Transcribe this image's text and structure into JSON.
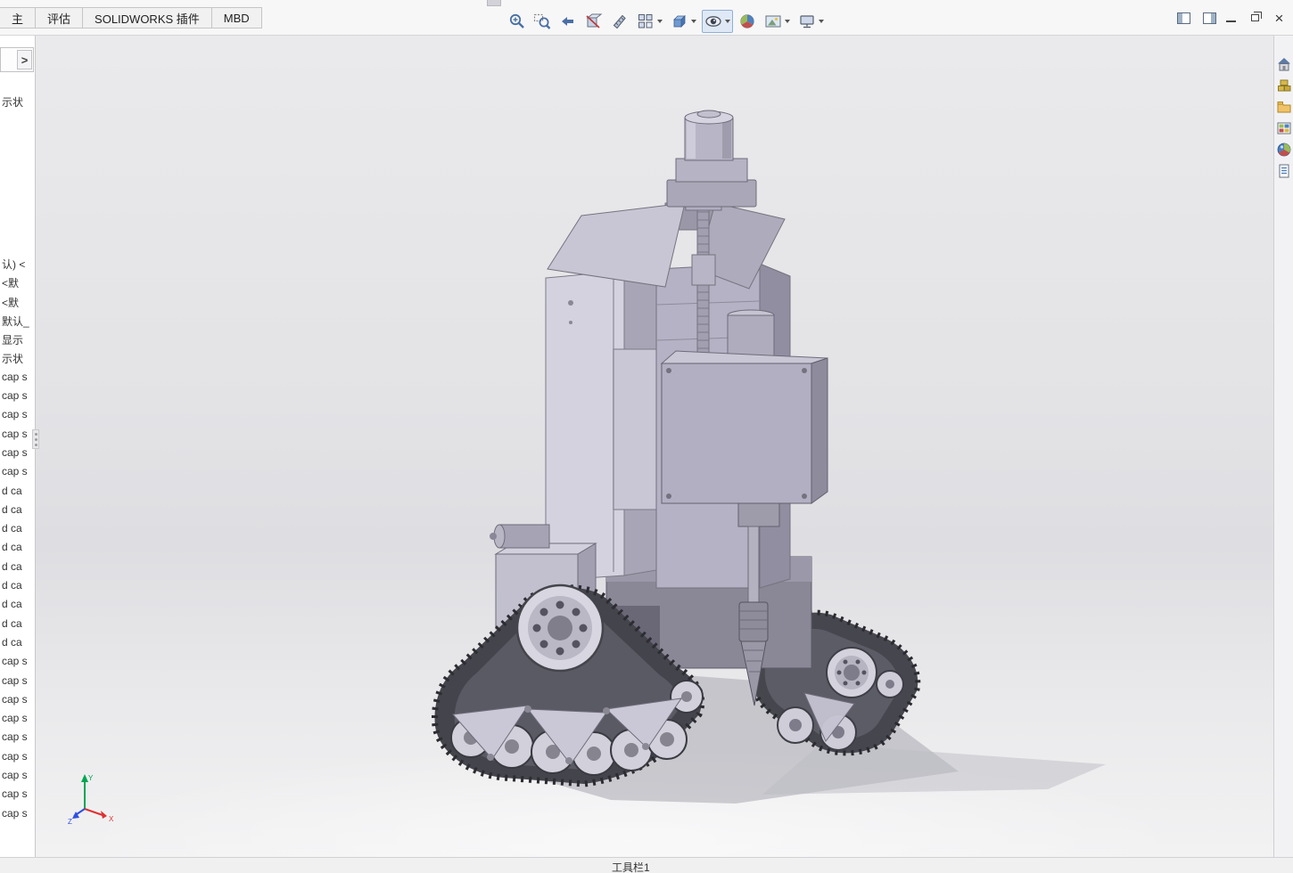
{
  "tabs": {
    "items": [
      "主",
      "评估",
      "SOLIDWORKS 插件",
      "MBD"
    ]
  },
  "toolbar": {
    "tools": [
      {
        "name": "zoom-fit"
      },
      {
        "name": "zoom-area"
      },
      {
        "name": "previous-view"
      },
      {
        "name": "section-view"
      },
      {
        "name": "measure"
      },
      {
        "name": "view-orientation",
        "dropdown": true
      },
      {
        "name": "display-style",
        "dropdown": true
      },
      {
        "name": "hide-show-items",
        "dropdown": true,
        "active": true
      },
      {
        "name": "edit-appearance"
      },
      {
        "name": "apply-scene",
        "dropdown": true
      },
      {
        "name": "view-settings",
        "dropdown": true
      }
    ]
  },
  "window_controls": {
    "pane_toggle_left": "collapse-pane",
    "pane_toggle_right": "expand-pane",
    "minimize": "minimize",
    "restore": "restore-down",
    "close": "close"
  },
  "sidebar": {
    "expand_button": ">",
    "top_item": "示状",
    "items": [
      "认) <",
      "<默",
      "<默",
      "默认_",
      "显示",
      "示状",
      "cap s",
      "cap s",
      "cap s",
      "cap s",
      "cap s",
      "cap s",
      "d ca",
      "d ca",
      "d ca",
      "d ca",
      "d ca",
      "d ca",
      "d ca",
      "d ca",
      "d ca",
      "cap s",
      "cap s",
      "cap s",
      "cap s",
      "cap s",
      "cap s",
      "cap s",
      "cap s",
      "cap s"
    ]
  },
  "taskpane": {
    "icons": [
      "solidworks-resources",
      "design-library",
      "file-explorer",
      "view-palette",
      "appearances-scenes",
      "custom-properties"
    ]
  },
  "viewport": {
    "triad": {
      "x": "X",
      "y": "Y",
      "z": "Z"
    }
  },
  "statusbar": {
    "left_text": "工具栏1"
  },
  "colors": {
    "viewport_top": "#eaeaec",
    "viewport_bottom": "#f2f2f3",
    "model_body": "#b2b0c2",
    "model_light": "#d4d2de",
    "model_dark": "#8e8c9e",
    "track": "#46464e",
    "wheel": "#d6d4de",
    "shadow": "#aeaeb5",
    "active_tool_border": "#8fb0d8"
  }
}
